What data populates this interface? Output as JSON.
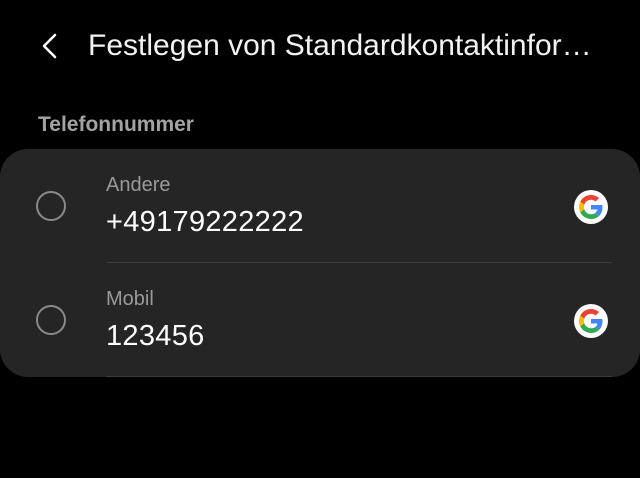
{
  "app_bar": {
    "title": "Festlegen von Standardkontaktinfor…",
    "back_icon": "chevron-left-icon"
  },
  "section": {
    "header": "Telefonnummer"
  },
  "phone_numbers": [
    {
      "type": "Andere",
      "number": "+49179222222",
      "account_icon": "google-icon",
      "selected": false
    },
    {
      "type": "Mobil",
      "number": "123456",
      "account_icon": "google-icon",
      "selected": false
    }
  ],
  "colors": {
    "background": "#000000",
    "card": "#252525",
    "primary_text": "#ffffff",
    "secondary_text": "#9a9a9a",
    "google_blue": "#4285F4",
    "google_red": "#EA4335",
    "google_yellow": "#FBBC05",
    "google_green": "#34A853"
  }
}
